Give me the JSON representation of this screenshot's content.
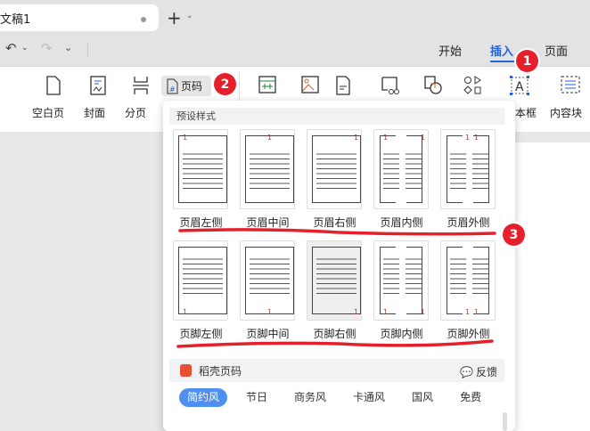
{
  "titlebar": {
    "doc_tab": "文稿1",
    "new_tab": "+"
  },
  "toolbar": {
    "menu_tabs": [
      "开始",
      "插入",
      "页面"
    ],
    "active_tab": "插入"
  },
  "ribbon": {
    "buttons": [
      "空白页",
      "封面",
      "分页"
    ],
    "page_number_button": "页码",
    "right_buttons": [
      "本框",
      "内容块"
    ]
  },
  "badges": [
    "1",
    "2",
    "3"
  ],
  "panel": {
    "section_title": "预设样式",
    "page_number": "1",
    "header_styles": [
      "页眉左侧",
      "页眉中间",
      "页眉右侧",
      "页眉内侧",
      "页眉外侧"
    ],
    "footer_styles": [
      "页脚左侧",
      "页脚中间",
      "页脚右侧",
      "页脚内侧",
      "页脚外侧"
    ],
    "brand": "稻壳页码",
    "feedback": "反馈",
    "categories": [
      "简约风",
      "节日",
      "商务风",
      "卡通风",
      "国风",
      "免费"
    ],
    "selected_category": "简约风"
  },
  "colors": {
    "accent": "#2563d8",
    "badge": "#e5202a",
    "chip": "#4e8ff0",
    "page_number": "#a0403a"
  }
}
